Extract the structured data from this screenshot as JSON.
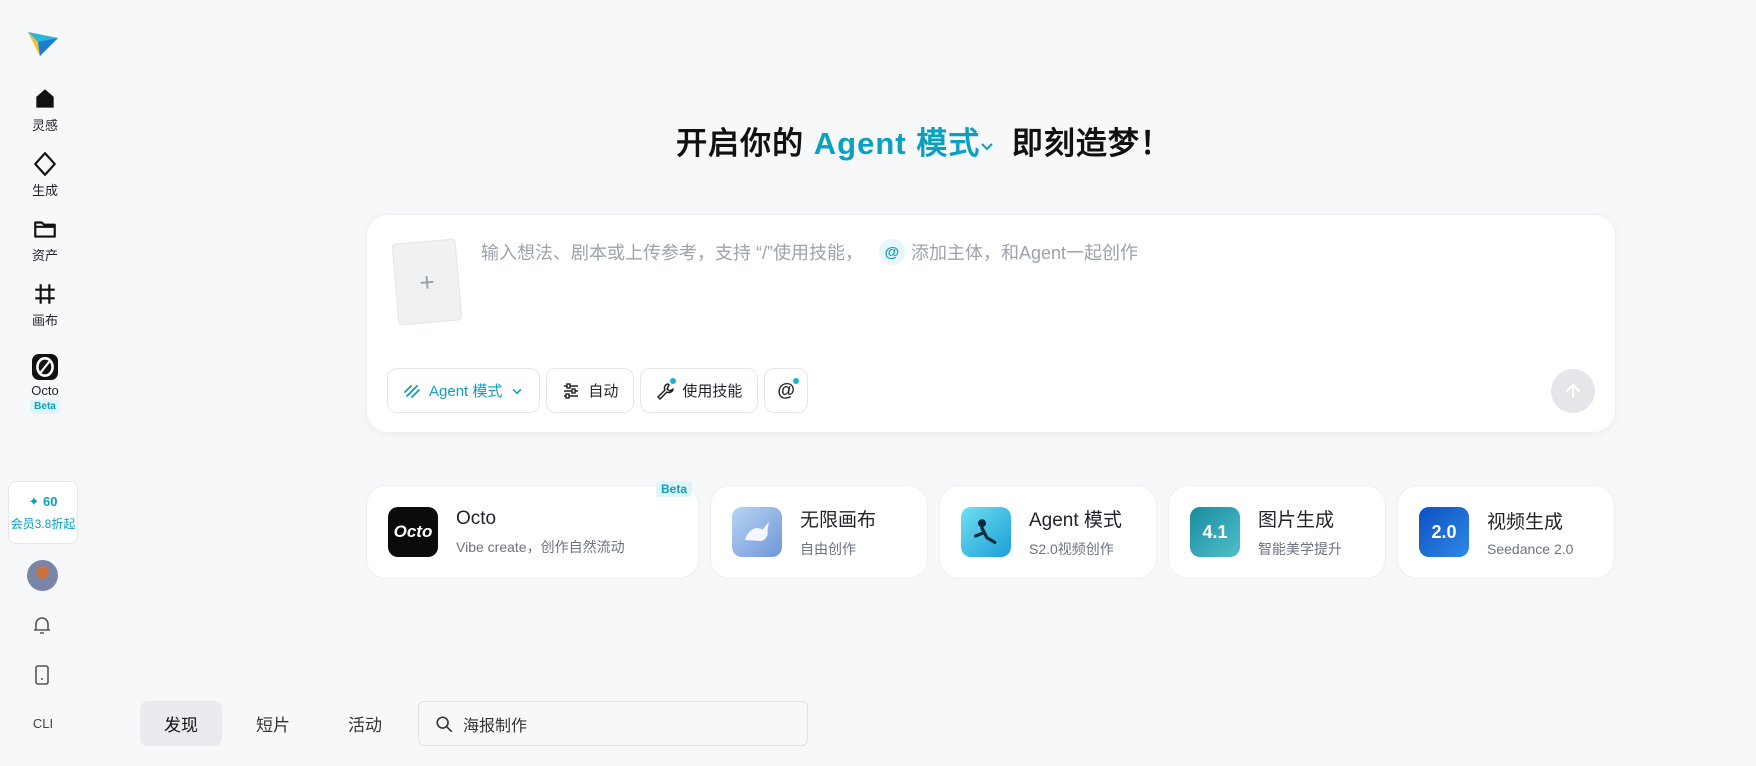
{
  "sidebar": {
    "nav": [
      {
        "label": "灵感",
        "icon": "home-icon"
      },
      {
        "label": "生成",
        "icon": "sparkle-diamond-icon"
      },
      {
        "label": "资产",
        "icon": "folder-icon"
      },
      {
        "label": "画布",
        "icon": "canvas-hash-icon"
      },
      {
        "label": "Octo",
        "icon": "octo-icon",
        "badge": "Beta"
      }
    ],
    "credits": {
      "points": "✦ 60",
      "promo": "会员3.8折起"
    },
    "cli_label": "CLI"
  },
  "heading": {
    "prefix": "开启你的 ",
    "mode": "Agent 模式",
    "suffix": " 即刻造梦！"
  },
  "composer": {
    "placeholder_part1": "输入想法、剧本或上传参考，支持 “/”使用技能，",
    "at_symbol": "@",
    "placeholder_part2": "添加主体，和Agent一起创作",
    "upload_plus": "+",
    "tools": {
      "agent": "Agent 模式",
      "auto": "自动",
      "skills": "使用技能",
      "mention": "@"
    }
  },
  "features": [
    {
      "title": "Octo",
      "subtitle": "Vibe create，创作自然流动",
      "badge": "Beta",
      "icon_text": "Octo"
    },
    {
      "title": "无限画布",
      "subtitle": "自由创作",
      "icon_text": ""
    },
    {
      "title": "Agent 模式",
      "subtitle": "S2.0视频创作",
      "icon_text": ""
    },
    {
      "title": "图片生成",
      "subtitle": "智能美学提升",
      "icon_text": "4.1"
    },
    {
      "title": "视频生成",
      "subtitle": "Seedance 2.0",
      "icon_text": "2.0"
    }
  ],
  "bottom": {
    "tabs": [
      "发现",
      "短片",
      "活动"
    ],
    "active_tab": "发现",
    "search_value": "海报制作"
  },
  "colors": {
    "accent": "#0aa0c0",
    "background": "#f7f8fa"
  }
}
